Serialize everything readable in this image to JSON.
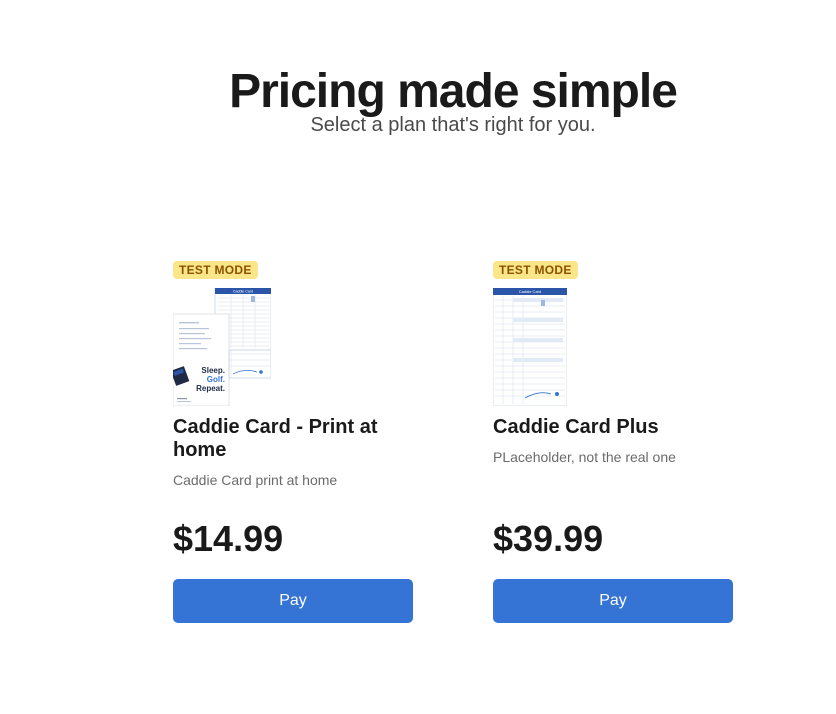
{
  "header": {
    "title": "Pricing made simple",
    "subtitle": "Select a plan that's right for you."
  },
  "plans": [
    {
      "badge": "TEST MODE",
      "name": "Caddie Card - Print at home",
      "description": "Caddie Card print at home",
      "price": "$14.99",
      "button_label": "Pay",
      "image": {
        "card_title": "Caddie Card",
        "slogan_lines": [
          "Sleep.",
          "Golf.",
          "Repeat."
        ]
      }
    },
    {
      "badge": "TEST MODE",
      "name": "Caddie Card Plus",
      "description": "PLaceholder, not the real one",
      "price": "$39.99",
      "button_label": "Pay",
      "image": {
        "card_title": "Caddie Card"
      }
    }
  ],
  "colors": {
    "accent": "#3574d4",
    "badge_bg": "#fde68a",
    "badge_text": "#8a5300",
    "card_header": "#2b55a8"
  }
}
